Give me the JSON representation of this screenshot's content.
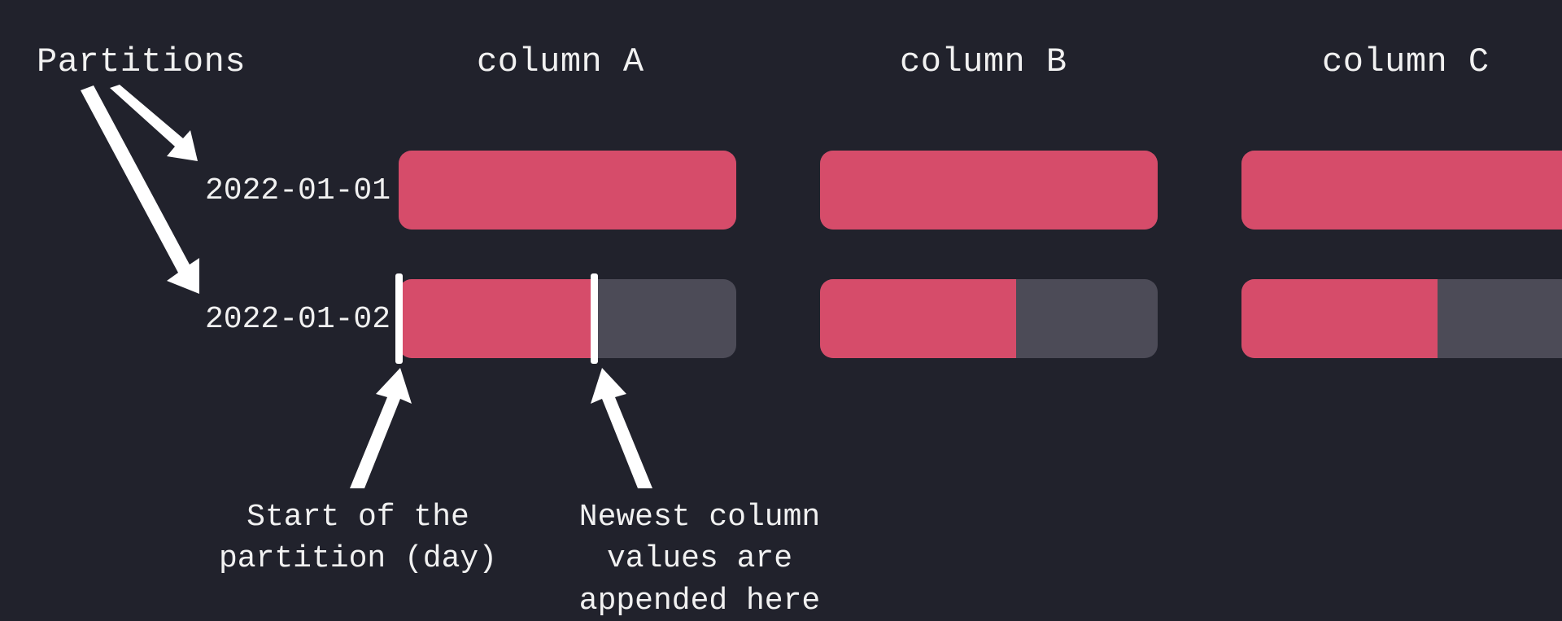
{
  "labels": {
    "partitions": "Partitions",
    "colA": "column A",
    "colB": "column B",
    "colC": "column C"
  },
  "rows": {
    "r1": "2022-01-01",
    "r2": "2022-01-02"
  },
  "annotations": {
    "start": "Start of the\npartition (day)",
    "newest": "Newest column\nvalues are\nappended here"
  },
  "fill": {
    "row1_pct": 100,
    "row2_pct": 58
  },
  "colors": {
    "bg": "#21222c",
    "barEmpty": "#4c4b57",
    "barFill": "#d64c6a",
    "text": "#f1f1f1",
    "arrow": "#ffffff"
  }
}
